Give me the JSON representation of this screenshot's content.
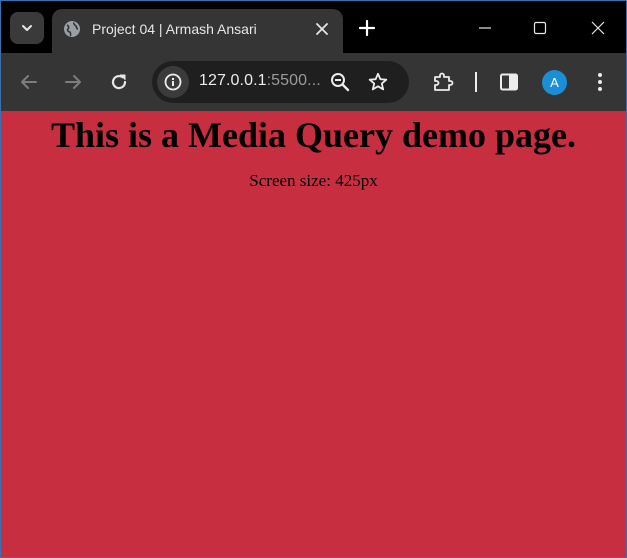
{
  "browser": {
    "tab": {
      "title": "Project 04 | Armash Ansari"
    },
    "address_bar": {
      "url_host": "127.0.0.1",
      "url_rest": ":5500..."
    },
    "profile": {
      "initial": "A"
    },
    "colors": {
      "titlebar": "#000000",
      "toolbar": "#353535",
      "omnibox": "#1f1f1f",
      "avatar": "#1a8fd6"
    },
    "icons": {
      "tab_search": "chevron-down-icon",
      "favicon": "globe-icon",
      "tab_close": "close-icon",
      "new_tab": "plus-icon",
      "minimize": "minimize-icon",
      "maximize": "maximize-icon",
      "window_close": "close-icon",
      "back": "arrow-left-icon",
      "forward": "arrow-right-icon",
      "reload": "reload-icon",
      "site_info": "info-icon",
      "zoom": "zoom-out-icon",
      "bookmark": "star-icon",
      "extensions": "puzzle-icon",
      "side_panel": "side-panel-icon",
      "menu": "kebab-menu-icon"
    }
  },
  "page": {
    "heading": "This is a Media Query demo page.",
    "screen_size_text": "Screen size: 425px",
    "background_color": "#c72f41"
  }
}
